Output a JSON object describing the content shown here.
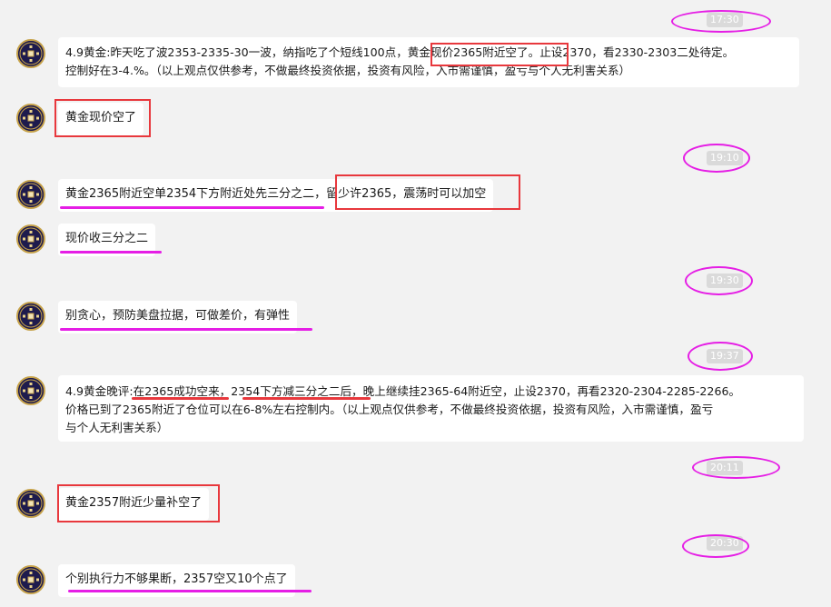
{
  "timestamps": [
    "17:30",
    "19:10",
    "19:30",
    "19:37",
    "20:11",
    "20:30"
  ],
  "messages": [
    {
      "line1": "4.9黄金:昨天吃了波2353-2335-30一波，纳指吃了个短线100点，黄金现价2365附近空了。止设2370，看2330-2303二处待定。",
      "line2": "控制好在3-4.%。（以上观点仅供参考，不做最终投资依据，投资有风险，入市需谨慎，盈亏与个人无利害关系）"
    },
    {
      "text": "黄金现价空了"
    },
    {
      "text": "黄金2365附近空单2354下方附近处先三分之二，留少许2365，震荡时可以加空"
    },
    {
      "text": "现价收三分之二"
    },
    {
      "text": "别贪心，预防美盘拉据，可做差价，有弹性"
    },
    {
      "line1": "4.9黄金晚评:在2365成功空来，2354下方减三分之二后，晚上继续挂2365-64附近空，止设2370，再看2320-2304-2285-2266。",
      "line2": "价格已到了2365附近了仓位可以在6-8%左右控制内。（以上观点仅供参考，不做最终投资依据，投资有风险，入市需谨慎，盈亏",
      "line3": "与个人无利害关系）"
    },
    {
      "text": "黄金2357附近少量补空了"
    },
    {
      "text": "个别执行力不够果断，2357空又10个点了"
    }
  ],
  "colors": {
    "annotation_magenta": "#e51ee5",
    "annotation_red": "#e8383d",
    "avatar_bg": "#1e1b4d",
    "avatar_ring": "#c6a24a"
  },
  "icons": {
    "avatar": "gold-coin-avatar-icon"
  }
}
